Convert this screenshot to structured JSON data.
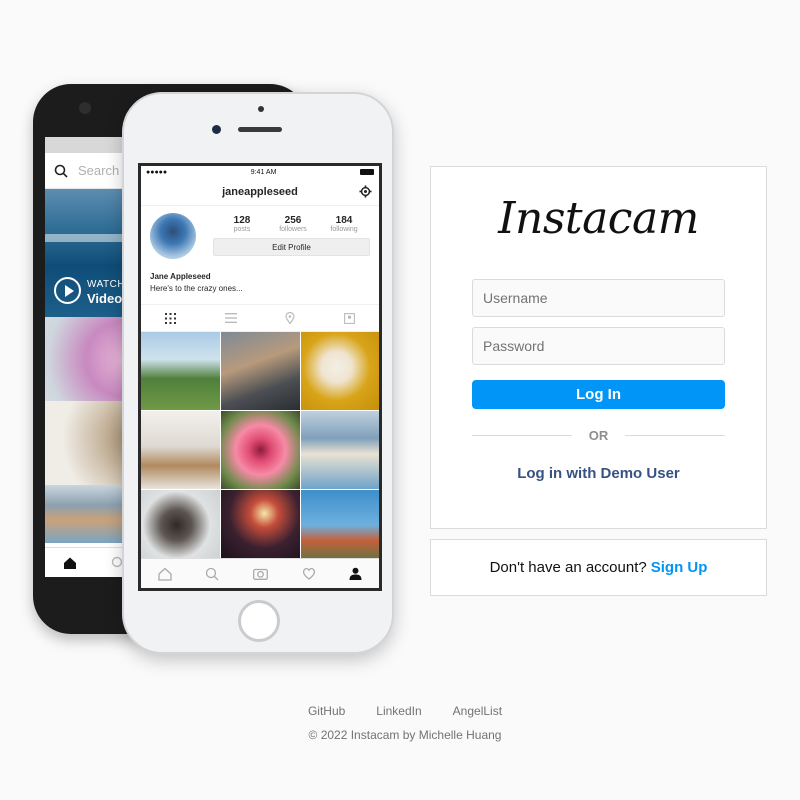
{
  "phone_back": {
    "search_placeholder": "Search",
    "video_watch": "WATCH",
    "video_title": "Video"
  },
  "phone_front": {
    "status_time": "9:41 AM",
    "username": "janeappleseed",
    "stats": [
      {
        "count": "128",
        "label": "posts"
      },
      {
        "count": "256",
        "label": "followers"
      },
      {
        "count": "184",
        "label": "following"
      }
    ],
    "edit_profile_label": "Edit Profile",
    "display_name": "Jane Appleseed",
    "bio": "Here's to the crazy ones..."
  },
  "login": {
    "logo": "Instacam",
    "username_placeholder": "Username",
    "password_placeholder": "Password",
    "login_button": "Log In",
    "or_text": "OR",
    "demo_link": "Log in with Demo User"
  },
  "signup": {
    "prompt": "Don't have an account?",
    "link": "Sign Up"
  },
  "footer": {
    "links": [
      "GitHub",
      "LinkedIn",
      "AngelList"
    ],
    "copyright": "© 2022 Instacam by Michelle Huang"
  },
  "colors": {
    "accent": "#0095f6",
    "demo_link": "#385185",
    "background": "#fafafa",
    "border": "#dbdbdb"
  }
}
